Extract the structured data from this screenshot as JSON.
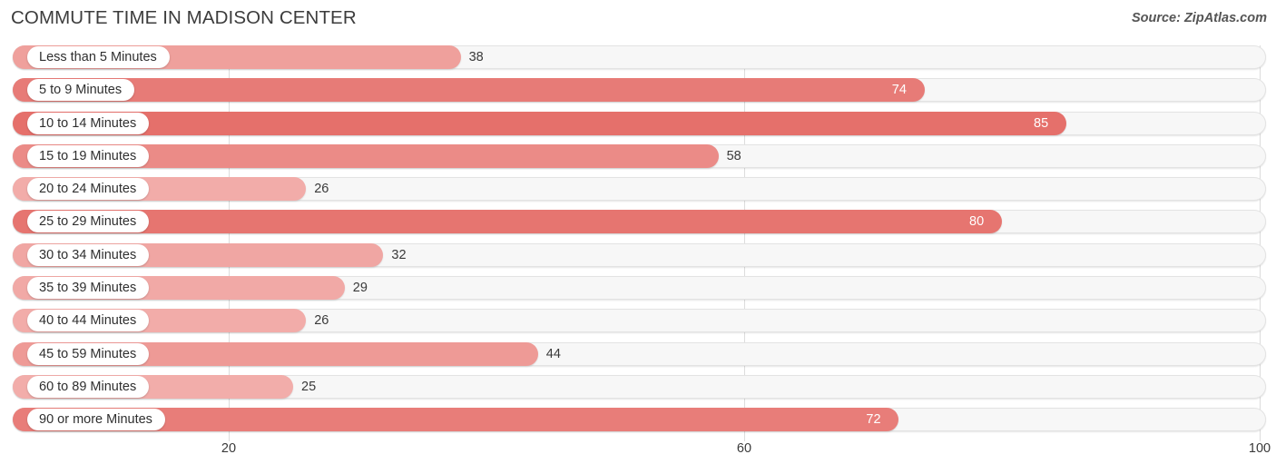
{
  "header": {
    "title": "COMMUTE TIME IN MADISON CENTER",
    "source": "Source: ZipAtlas.com"
  },
  "colors": {
    "bar_low": "#F2ADAA",
    "bar_high": "#E5706B",
    "track_fill": "#F7F7F7",
    "track_border": "#E3E3E3",
    "gridline": "#DCDCDC",
    "label_text": "#2F2F2F",
    "value_text_outside": "#3A3A3A",
    "value_text_inside": "#FFFFFF"
  },
  "chart_data": {
    "type": "bar",
    "orientation": "horizontal",
    "title": "COMMUTE TIME IN MADISON CENTER",
    "xlabel": "",
    "ylabel": "",
    "xlim": [
      0,
      105
    ],
    "xticks": [
      20,
      60,
      100
    ],
    "xticklabels": [
      "20",
      "60",
      "100"
    ],
    "grid": true,
    "legend": null,
    "categories": [
      "Less than 5 Minutes",
      "5 to 9 Minutes",
      "10 to 14 Minutes",
      "15 to 19 Minutes",
      "20 to 24 Minutes",
      "25 to 29 Minutes",
      "30 to 34 Minutes",
      "35 to 39 Minutes",
      "40 to 44 Minutes",
      "45 to 59 Minutes",
      "60 to 89 Minutes",
      "90 or more Minutes"
    ],
    "values": [
      38,
      74,
      85,
      58,
      26,
      80,
      32,
      29,
      26,
      44,
      25,
      72
    ],
    "value_labels": [
      "38",
      "74",
      "85",
      "58",
      "26",
      "80",
      "32",
      "29",
      "26",
      "44",
      "25",
      "72"
    ]
  },
  "axis": {
    "ticks": [
      {
        "label": "20",
        "value": 20
      },
      {
        "label": "60",
        "value": 60
      },
      {
        "label": "100",
        "value": 100
      }
    ]
  }
}
